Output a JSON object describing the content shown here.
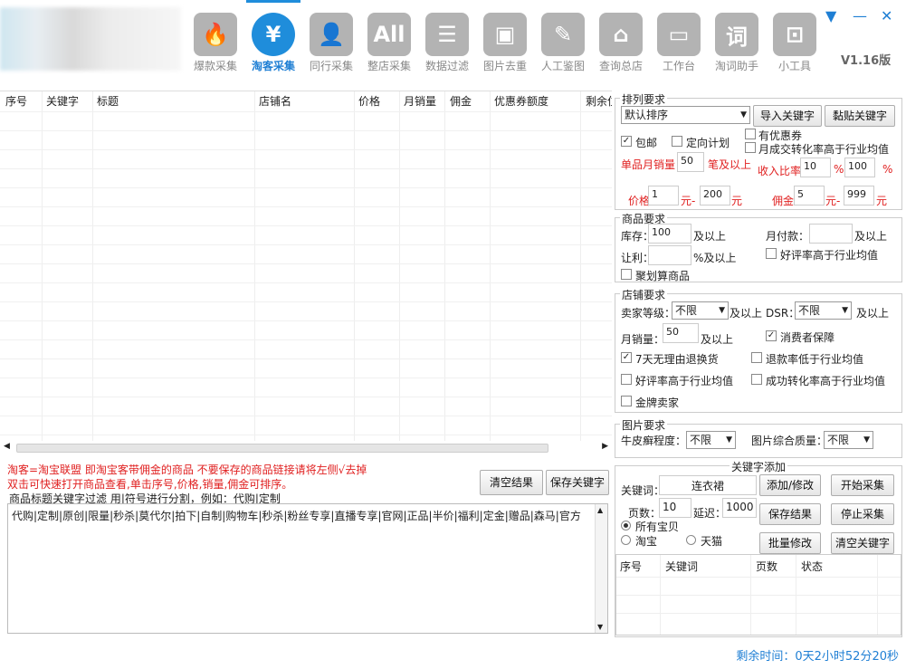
{
  "nav": [
    {
      "label": "爆款采集",
      "icon": "flame-icon",
      "glyph": "🔥"
    },
    {
      "label": "淘客采集",
      "icon": "yen-icon",
      "glyph": "¥"
    },
    {
      "label": "同行采集",
      "icon": "user-icon",
      "glyph": "👤"
    },
    {
      "label": "整店采集",
      "icon": "all-icon",
      "glyph": "All"
    },
    {
      "label": "数据过滤",
      "icon": "filter-icon",
      "glyph": "☰"
    },
    {
      "label": "图片去重",
      "icon": "image-icon",
      "glyph": "▣"
    },
    {
      "label": "人工鉴图",
      "icon": "person-icon",
      "glyph": "✎"
    },
    {
      "label": "查询总店",
      "icon": "house-icon",
      "glyph": "⌂"
    },
    {
      "label": "工作台",
      "icon": "monitor-icon",
      "glyph": "▭"
    },
    {
      "label": "淘词助手",
      "icon": "word-icon",
      "glyph": "词"
    },
    {
      "label": "小工具",
      "icon": "toolbox-icon",
      "glyph": "⊡"
    }
  ],
  "version": "V1.16版",
  "window": {
    "min": "▼",
    "restore": "—",
    "close": "✕"
  },
  "grid": {
    "columns": [
      "序号",
      "关键字",
      "标题",
      "店铺名",
      "价格",
      "月销量",
      "佣金",
      "优惠券额度",
      "剩余位"
    ]
  },
  "notes": {
    "line1": "淘客=淘宝联盟 即淘宝客带佣金的商品 不要保存的商品链接请将左侧√去掉",
    "line2": "双击可快速打开商品查看,单击序号,价格,销量,佣金可排序。"
  },
  "buttons": {
    "clear": "清空结果",
    "save_kw": "保存关键字"
  },
  "filter": {
    "label": "商品标题关键字过滤 用|符号进行分割，例如：代购|定制",
    "text": "代购|定制|原创|限量|秒杀|莫代尔|拍下|自制|购物车|秒杀|粉丝专享|直播专享|官网|正品|半价|福利|定金|赠品|森马|官方"
  },
  "sort": {
    "title": "排列要求",
    "select": "默认排序",
    "import": "导入关键字",
    "paste": "黏贴关键字",
    "baoyou": "包邮",
    "dingxiang": "定向计划",
    "youhuiquan": "有优惠券",
    "yuechengjiao": "月成交转化率高于行业均值",
    "monthly_sales_label": "单品月销量",
    "monthly_sales": "50",
    "monthly_sales_unit": "笔及以上",
    "income_label": "收入比率",
    "income_min": "10",
    "income_sep": "%-",
    "income_max": "100",
    "income_unit": "%",
    "price_label": "价格",
    "price_min": "1",
    "price_sep": "元-",
    "price_max": "200",
    "price_unit": "元",
    "commission_label": "佣金",
    "commission_min": "5",
    "commission_sep": "元-",
    "commission_max": "999",
    "commission_unit": "元"
  },
  "goods": {
    "title": "商品要求",
    "stock_label": "库存：",
    "stock": "100",
    "stock_unit": "及以上",
    "pay_label": "月付款：",
    "pay": "",
    "pay_unit": "及以上",
    "discount_label": "让利：",
    "discount": "",
    "discount_unit": "%及以上",
    "good_rate": "好评率高于行业均值",
    "juhuasuan": "聚划算商品"
  },
  "shop": {
    "title": "店铺要求",
    "level_label": "卖家等级：",
    "level": "不限",
    "level_unit": "及以上",
    "dsr_label": "DSR：",
    "dsr": "不限",
    "dsr_unit": "及以上",
    "sales_label": "月销量：",
    "sales": "50",
    "sales_unit": "及以上",
    "consumer": "消费者保障",
    "return7": "7天无理由退换货",
    "refund": "退款率低于行业均值",
    "good_rate": "好评率高于行业均值",
    "conversion": "成功转化率高于行业均值",
    "gold": "金牌卖家"
  },
  "image": {
    "title": "图片要求",
    "psoriasis_label": "牛皮癣程度：",
    "psoriasis": "不限",
    "quality_label": "图片综合质量：",
    "quality": "不限"
  },
  "kw": {
    "title": "关键字添加",
    "kw_label": "关键词：",
    "kw": "连衣裙",
    "add": "添加/修改",
    "start": "开始采集",
    "pages_label": "页数：",
    "pages": "10",
    "delay_label": "延迟：",
    "delay": "1000",
    "save": "保存结果",
    "stop": "停止采集",
    "all": "所有宝贝",
    "taobao": "淘宝",
    "tmall": "天猫",
    "batch": "批量修改",
    "clearkw": "清空关键字",
    "columns": [
      "序号",
      "关键词",
      "页数",
      "状态"
    ]
  },
  "status": "剩余时间：0天2小时52分20秒"
}
